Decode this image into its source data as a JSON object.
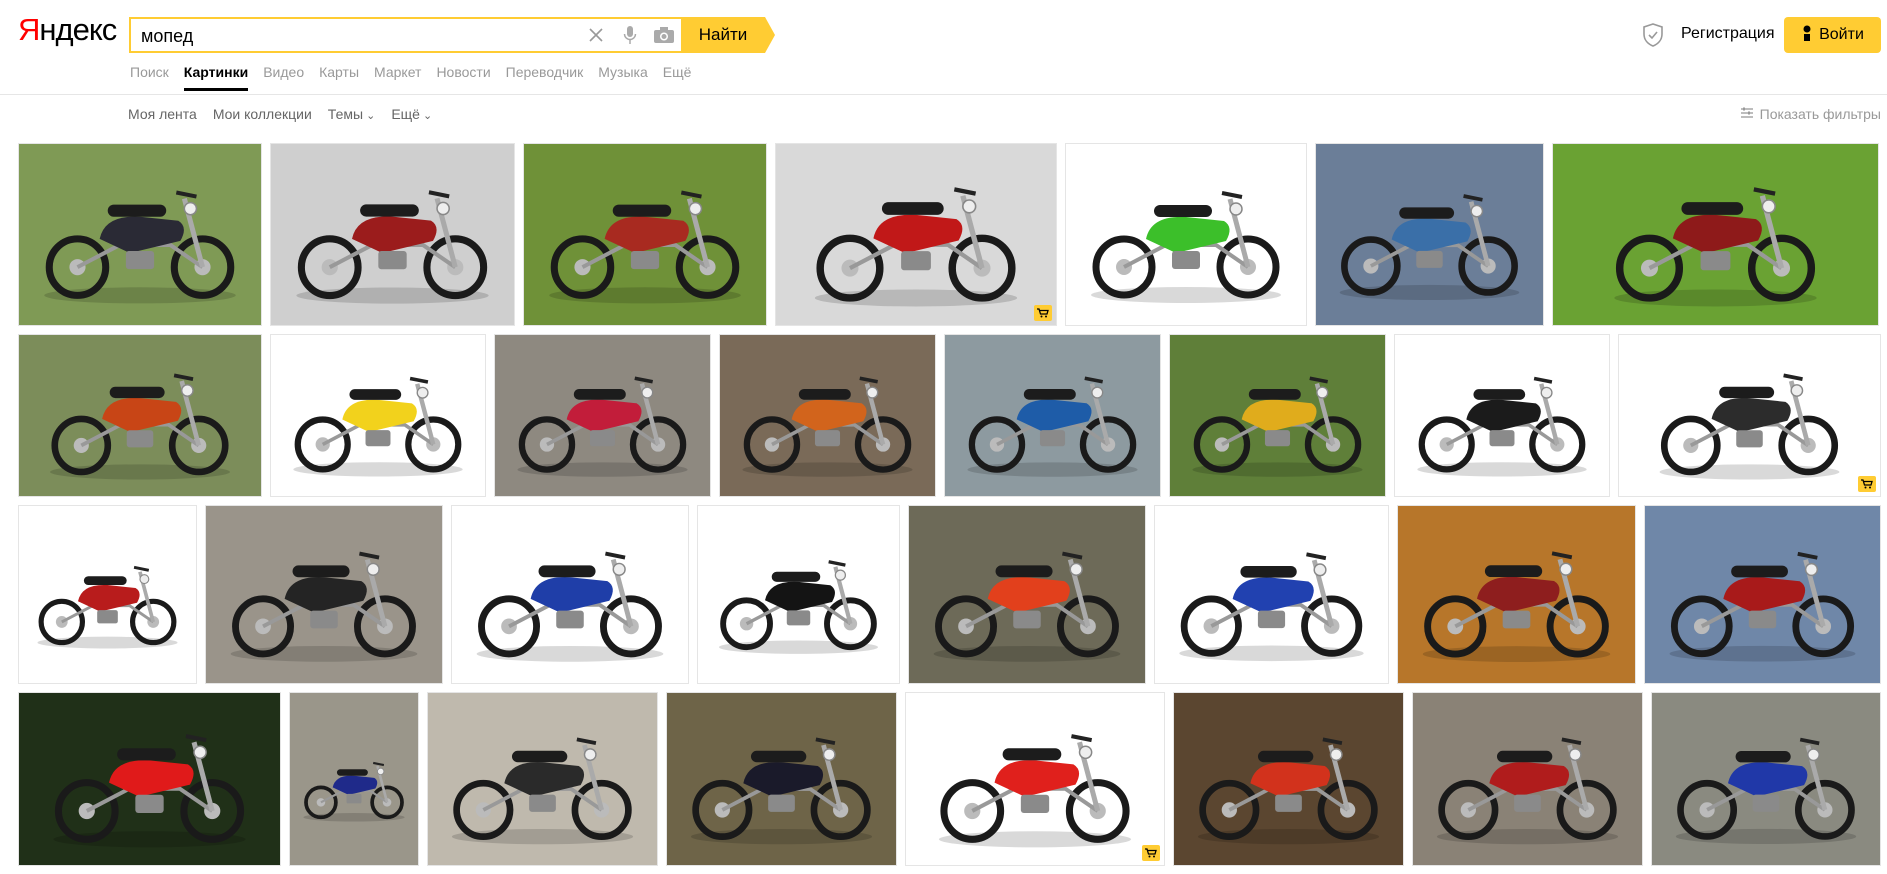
{
  "header": {
    "logo": "Яндекс",
    "search_query": "мопед",
    "find_label": "Найти",
    "register_label": "Регистрация",
    "login_label": "Войти"
  },
  "tabs": [
    "Поиск",
    "Картинки",
    "Видео",
    "Карты",
    "Маркет",
    "Новости",
    "Переводчик",
    "Музыка",
    "Ещё"
  ],
  "active_tab": "Картинки",
  "subnav": {
    "feed": "Моя лента",
    "collections": "Мои коллекции",
    "themes": "Темы",
    "more": "Ещё",
    "show_filters": "Показать фильтры"
  },
  "colors": {
    "accent": "#ffcc33",
    "logo_red": "#ff0000"
  },
  "images": [
    [
      {
        "bg": "#7f9a55",
        "body": "#2a2a35",
        "shop": false
      },
      {
        "bg": "#cfcfcf",
        "body": "#9b1c1c",
        "shop": false
      },
      {
        "bg": "#6f9138",
        "body": "#a82a20",
        "shop": false
      },
      {
        "bg": "#d9d9d9",
        "body": "#c11818",
        "shop": true
      },
      {
        "bg": "#ffffff",
        "body": "#3cbf2a",
        "shop": false
      },
      {
        "bg": "#6b7e98",
        "body": "#3a6fa8",
        "shop": false
      },
      {
        "bg": "#6aa233",
        "body": "#8e1a1a",
        "shop": false
      }
    ],
    [
      {
        "bg": "#7c8d5a",
        "body": "#c84516",
        "shop": false
      },
      {
        "bg": "#ffffff",
        "body": "#f2d21c",
        "shop": false
      },
      {
        "bg": "#8e8980",
        "body": "#c21d3a",
        "shop": false
      },
      {
        "bg": "#7a6a58",
        "body": "#d2641c",
        "shop": false
      },
      {
        "bg": "#8d9aa0",
        "body": "#1e5ca8",
        "shop": false
      },
      {
        "bg": "#5f7f39",
        "body": "#e0ac1c",
        "shop": false
      },
      {
        "bg": "#ffffff",
        "body": "#1b1b1b",
        "shop": false
      },
      {
        "bg": "#ffffff",
        "body": "#2c2c2c",
        "shop": true
      }
    ],
    [
      {
        "bg": "#ffffff",
        "body": "#b81c1c",
        "shop": false
      },
      {
        "bg": "#9a948a",
        "body": "#242424",
        "shop": false
      },
      {
        "bg": "#ffffff",
        "body": "#1f3ea8",
        "shop": false
      },
      {
        "bg": "#ffffff",
        "body": "#141414",
        "shop": false
      },
      {
        "bg": "#6d6a58",
        "body": "#e2401c",
        "shop": false
      },
      {
        "bg": "#ffffff",
        "body": "#2141b0",
        "shop": false
      },
      {
        "bg": "#b7762a",
        "body": "#8e1e1e",
        "shop": false
      },
      {
        "bg": "#6f87a8",
        "body": "#a81a1a",
        "shop": false
      }
    ],
    [
      {
        "bg": "#203018",
        "body": "#e01a1a",
        "shop": false
      },
      {
        "bg": "#9a968a",
        "body": "#1f2a8a",
        "shop": false
      },
      {
        "bg": "#bfb9ad",
        "body": "#2a2a2a",
        "shop": false
      },
      {
        "bg": "#6e6448",
        "body": "#1a1a2a",
        "shop": false
      },
      {
        "bg": "#ffffff",
        "body": "#e0201c",
        "shop": true
      },
      {
        "bg": "#5b4630",
        "body": "#d2321c",
        "shop": false
      },
      {
        "bg": "#8a8276",
        "body": "#b01c1c",
        "shop": false
      },
      {
        "bg": "#8a8a80",
        "body": "#2038a8",
        "shop": false
      }
    ]
  ]
}
